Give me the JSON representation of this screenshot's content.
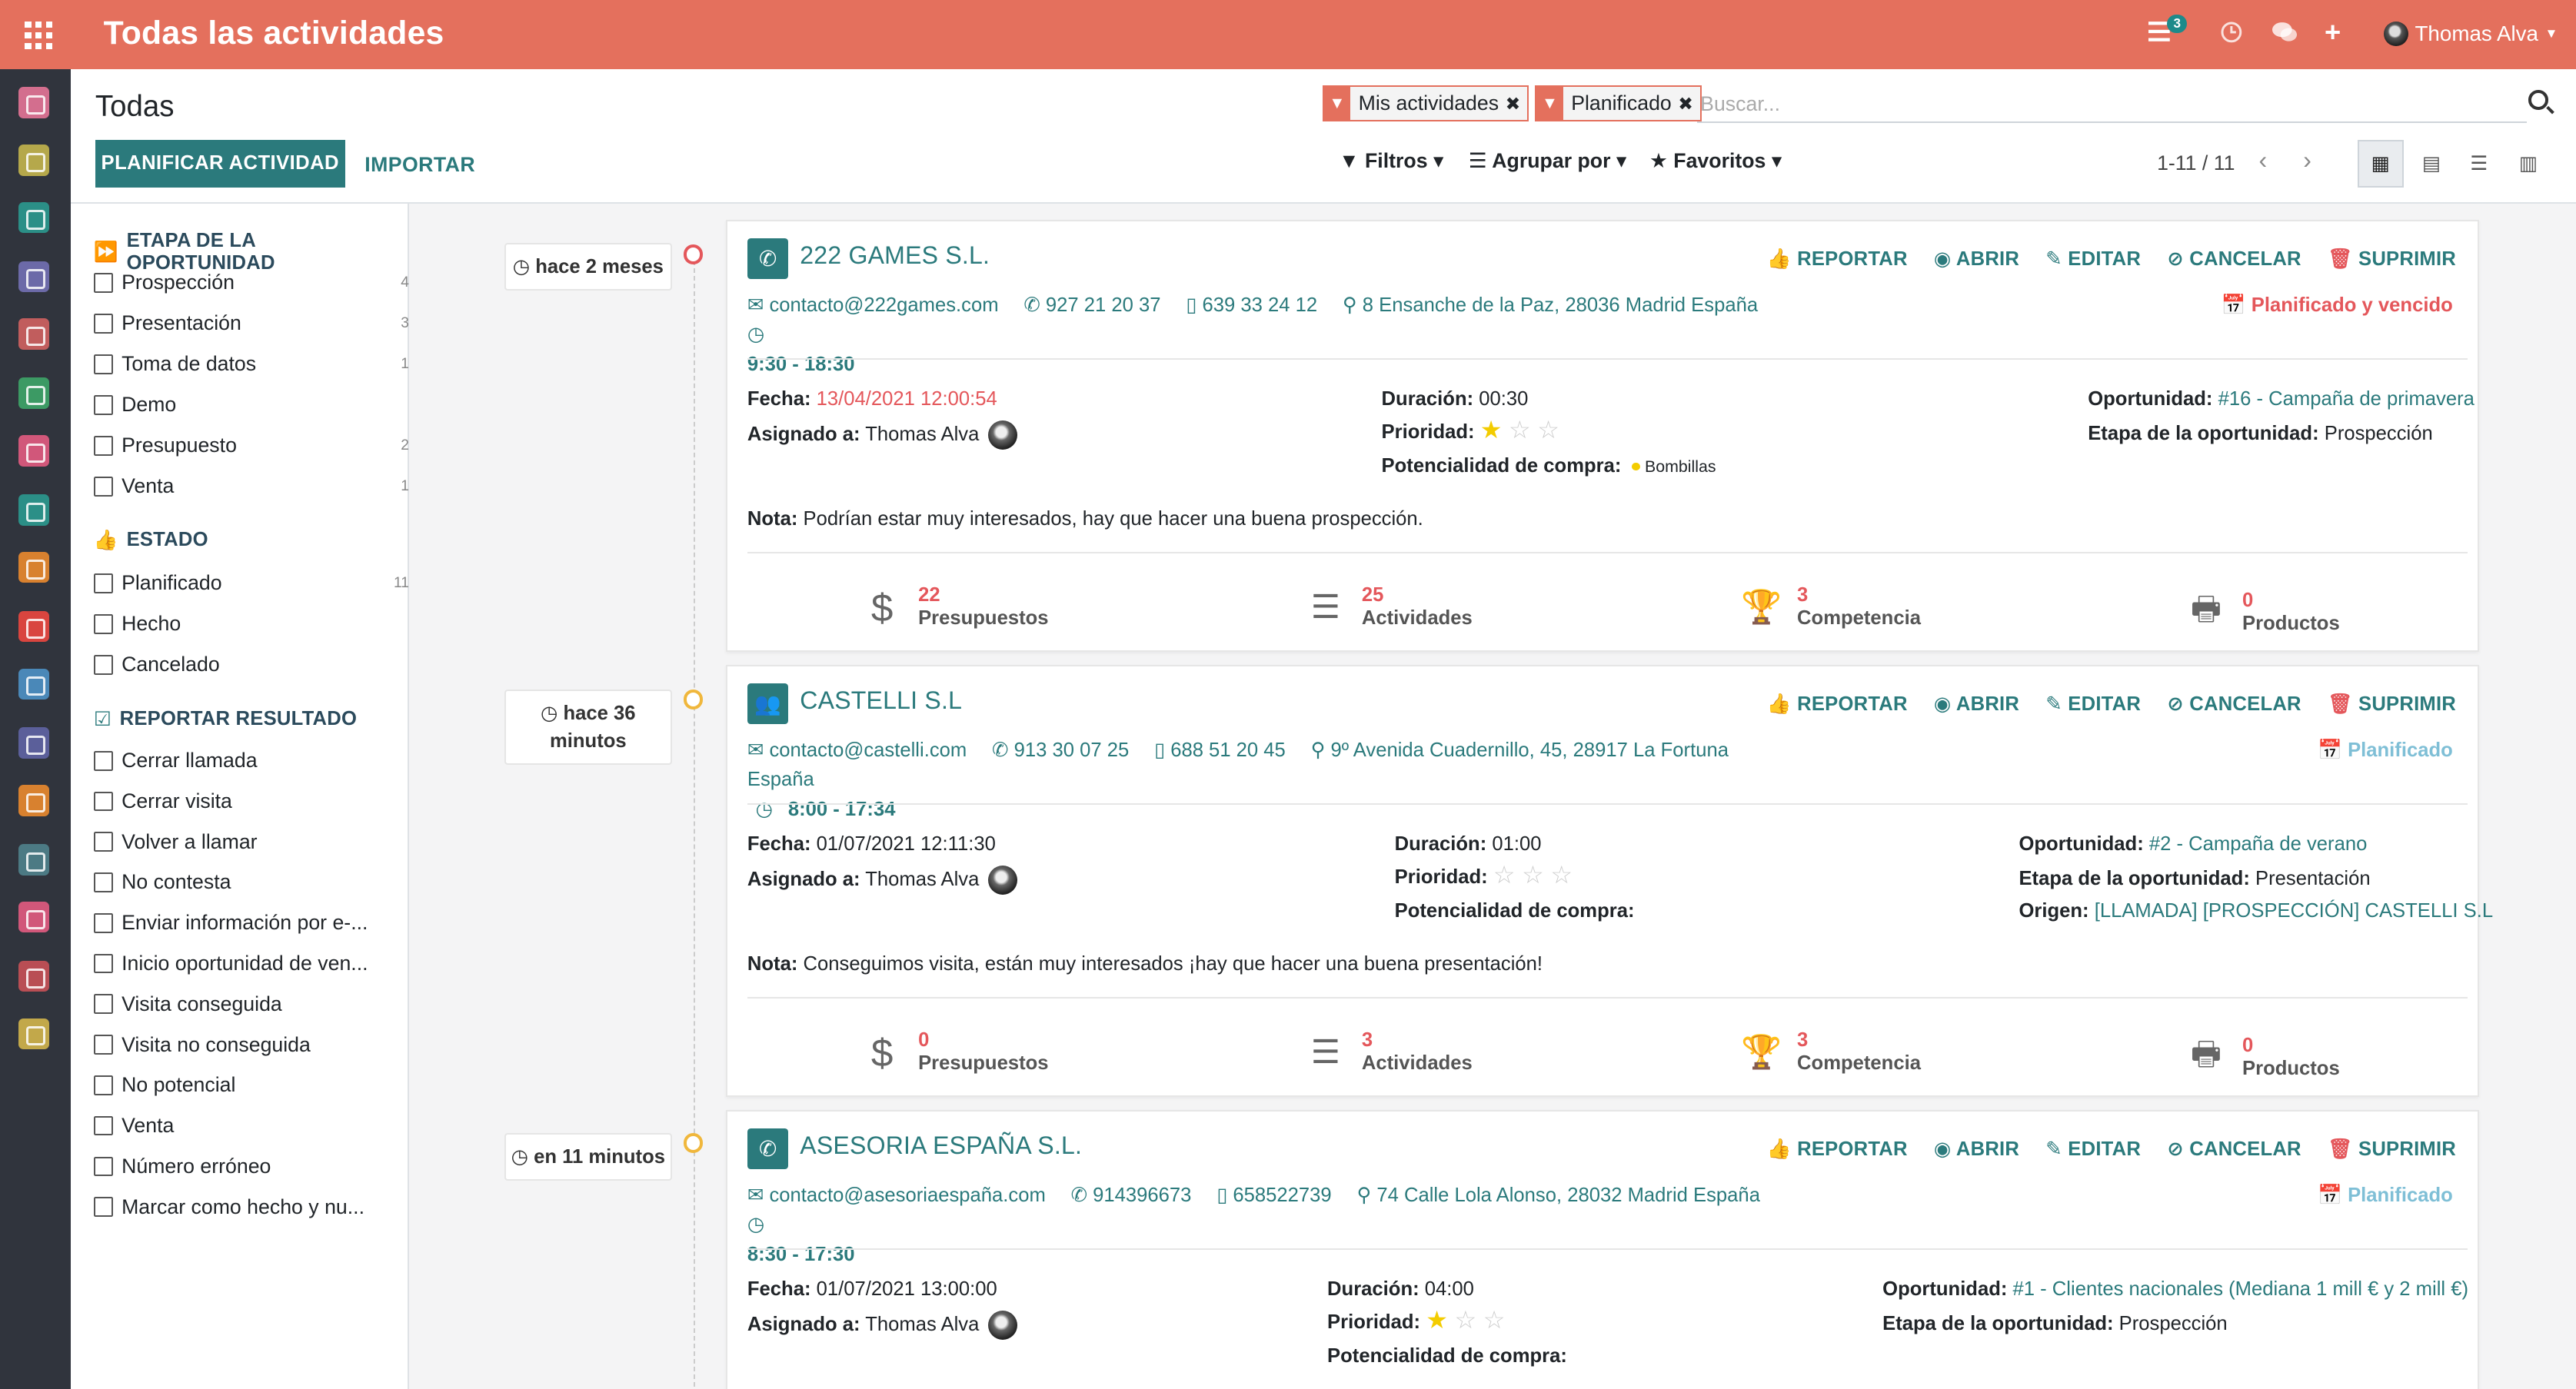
{
  "app": {
    "title": "Todas las actividades"
  },
  "topbar": {
    "badge": "3",
    "user": "Thomas Alva"
  },
  "breadcrumb": "Todas",
  "buttons": {
    "plan": "PLANIFICAR ACTIVIDAD",
    "import": "IMPORTAR"
  },
  "search": {
    "facets": [
      "Mis actividades",
      "Planificado"
    ],
    "placeholder": "Buscar...",
    "filters": "Filtros",
    "group": "Agrupar por",
    "favs": "Favoritos"
  },
  "pager": "1-11 / 11",
  "sections": {
    "stage": {
      "title": "ETAPA DE LA OPORTUNIDAD",
      "items": [
        {
          "label": "Prospección",
          "count": "4"
        },
        {
          "label": "Presentación",
          "count": "3"
        },
        {
          "label": "Toma de datos",
          "count": "1"
        },
        {
          "label": "Demo",
          "count": ""
        },
        {
          "label": "Presupuesto",
          "count": "2"
        },
        {
          "label": "Venta",
          "count": "1"
        }
      ]
    },
    "estado": {
      "title": "ESTADO",
      "items": [
        {
          "label": "Planificado",
          "count": "11"
        },
        {
          "label": "Hecho",
          "count": ""
        },
        {
          "label": "Cancelado",
          "count": ""
        }
      ]
    },
    "result": {
      "title": "REPORTAR RESULTADO",
      "items": [
        {
          "label": "Cerrar llamada"
        },
        {
          "label": "Cerrar visita"
        },
        {
          "label": "Volver a llamar"
        },
        {
          "label": "No contesta"
        },
        {
          "label": "Enviar información por e-..."
        },
        {
          "label": "Inicio oportunidad de ven..."
        },
        {
          "label": "Visita conseguida"
        },
        {
          "label": "Visita no conseguida"
        },
        {
          "label": "No potencial"
        },
        {
          "label": "Venta"
        },
        {
          "label": "Número erróneo"
        },
        {
          "label": "Marcar como hecho y nu..."
        }
      ]
    }
  },
  "actions": {
    "report": "REPORTAR",
    "open": "ABRIR",
    "edit": "EDITAR",
    "cancel": "CANCELAR",
    "delete": "SUPRIMIR"
  },
  "labels": {
    "fecha": "Fecha:",
    "asignado": "Asignado a:",
    "duracion": "Duración:",
    "prioridad": "Prioridad:",
    "potencial": "Potencialidad de compra:",
    "oportunidad": "Oportunidad:",
    "etapa": "Etapa de la oportunidad:",
    "origen": "Origen:",
    "nota": "Nota:",
    "presupuestos": "Presupuestos",
    "actividades": "Actividades",
    "competencia": "Competencia",
    "productos": "Productos"
  },
  "cards": [
    {
      "time": "hace 2 meses",
      "name": "222 GAMES S.L.",
      "email": "contacto@222games.com",
      "phone": "927 21 20 37",
      "mobile": "639 33 24 12",
      "address": "8 Ensanche de la Paz, 28036 Madrid España",
      "hours": "9:30 - 18:30",
      "state": "Planificado y vencido",
      "fecha": "13/04/2021 12:00:54",
      "asignado": "Thomas Alva",
      "duracion": "00:30",
      "prioridad": 1,
      "potencial": "Bombillas",
      "oportunidad": "#16 - Campaña de primavera",
      "etapa": "Prospección",
      "nota": "Podrían estar muy interesados, hay que hacer una buena prospección.",
      "stats": {
        "presupuestos": "22",
        "actividades": "25",
        "competencia": "3",
        "productos": "0"
      }
    },
    {
      "time": "hace 36 minutos",
      "name": "CASTELLI S.L",
      "email": "contacto@castelli.com",
      "phone": "913 30 07 25",
      "mobile": "688 51 20 45",
      "address": "9º Avenida Cuadernillo, 45, 28917 La Fortuna España",
      "hours": "8:00 - 17:34",
      "state": "Planificado",
      "fecha": "01/07/2021 12:11:30",
      "asignado": "Thomas Alva",
      "duracion": "01:00",
      "prioridad": 0,
      "potencial": "",
      "oportunidad": "#2 - Campaña de verano",
      "etapa": "Presentación",
      "origen": "[LLAMADA] [PROSPECCIÓN] CASTELLI S.L",
      "nota": "Conseguimos visita, están muy interesados ¡hay que hacer una buena presentación!",
      "stats": {
        "presupuestos": "0",
        "actividades": "3",
        "competencia": "3",
        "productos": "0"
      }
    },
    {
      "time": "en 11 minutos",
      "name": "ASESORIA ESPAÑA S.L.",
      "email": "contacto@asesoriaespaña.com",
      "phone": "914396673",
      "mobile": "658522739",
      "address": "74 Calle Lola Alonso, 28032 Madrid España",
      "hours": "8:30 - 17:30",
      "state": "Planificado",
      "fecha": "01/07/2021 13:00:00",
      "asignado": "Thomas Alva",
      "duracion": "04:00",
      "prioridad": 1,
      "potencial": "",
      "oportunidad": "#1 - Clientes nacionales (Mediana 1 mill € y 2 mill €)",
      "etapa": "Prospección"
    }
  ],
  "colors": {
    "brand": "#e4705d",
    "primary": "#2b7a7c",
    "danger": "#e4575b",
    "sidebar": "#30343d"
  }
}
